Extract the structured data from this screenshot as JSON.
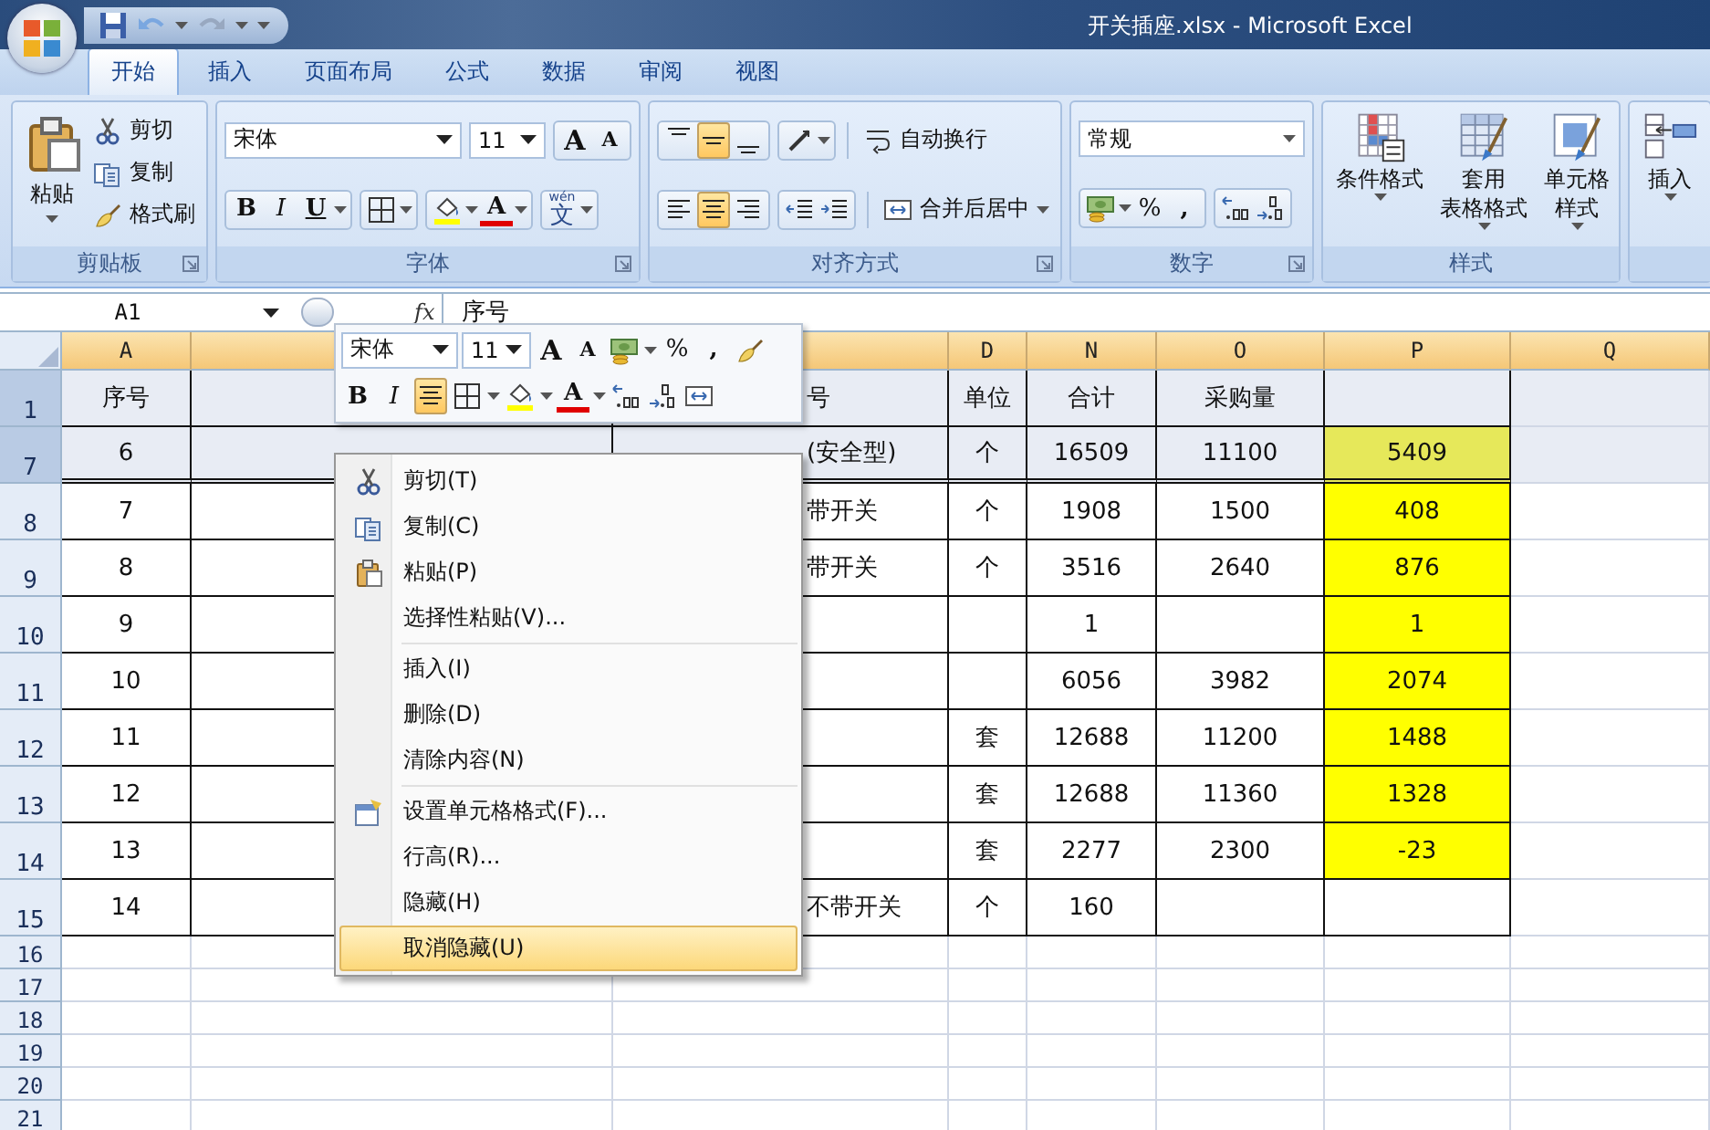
{
  "title_bar": {
    "title": "开关插座.xlsx - Microsoft Excel"
  },
  "tabs": [
    {
      "label": "开始",
      "selected": true
    },
    {
      "label": "插入",
      "selected": false
    },
    {
      "label": "页面布局",
      "selected": false
    },
    {
      "label": "公式",
      "selected": false
    },
    {
      "label": "数据",
      "selected": false
    },
    {
      "label": "审阅",
      "selected": false
    },
    {
      "label": "视图",
      "selected": false
    }
  ],
  "ribbon": {
    "clipboard": {
      "label": "剪贴板",
      "paste": "粘贴",
      "items": [
        {
          "label": "剪切"
        },
        {
          "label": "复制"
        },
        {
          "label": "格式刷"
        }
      ]
    },
    "font": {
      "label": "字体",
      "font_name": "宋体",
      "font_size": "11",
      "grow": "A",
      "shrink": "A",
      "bold": "B",
      "italic": "I",
      "underline": "U",
      "font_color": "A",
      "phonetic": {
        "ruby": "wén",
        "char": "文"
      }
    },
    "alignment": {
      "label": "对齐方式",
      "vertical": [
        {
          "kind": "top",
          "selected": false
        },
        {
          "kind": "middle",
          "selected": true
        },
        {
          "kind": "bottom",
          "selected": false
        }
      ],
      "horizontal": [
        {
          "kind": "left",
          "selected": false
        },
        {
          "kind": "center",
          "selected": true
        },
        {
          "kind": "right",
          "selected": false
        }
      ],
      "wrap": "自动换行",
      "merge": "合并后居中"
    },
    "number": {
      "label": "数字",
      "format": "常规",
      "percent": "%",
      "comma": ","
    },
    "styles": {
      "label": "样式",
      "buttons": [
        {
          "kind": "conditional",
          "lines": [
            "条件格式"
          ]
        },
        {
          "kind": "table",
          "lines": [
            "套用",
            "表格格式"
          ]
        },
        {
          "kind": "cell",
          "lines": [
            "单元格",
            "样式"
          ]
        }
      ]
    },
    "cells": {
      "buttons": [
        {
          "kind": "insert",
          "lines": [
            "插入"
          ]
        }
      ]
    }
  },
  "formula_bar": {
    "name_box": "A1",
    "fx": "fx",
    "formula": "序号"
  },
  "grid": {
    "columns": [
      {
        "label": "A"
      },
      {},
      {},
      {
        "label": "D"
      },
      {
        "label": "N"
      },
      {
        "label": "O"
      },
      {
        "label": "P"
      },
      {
        "label": "Q"
      }
    ],
    "rows": [
      {
        "header": "1",
        "selected": true,
        "highlighted": false,
        "rows_hidden_below": false,
        "cells": [
          "序号",
          null,
          "号",
          "单位",
          "合计",
          "采购量",
          null,
          null
        ]
      },
      {
        "header": "7",
        "selected": true,
        "highlighted": true,
        "rows_hidden_below": true,
        "cells": [
          "6",
          null,
          "(安全型)",
          "个",
          "16509",
          "11100",
          "5409",
          null
        ]
      },
      {
        "header": "8",
        "selected": false,
        "highlighted": true,
        "rows_hidden_below": false,
        "cells": [
          "7",
          null,
          "带开关",
          "个",
          "1908",
          "1500",
          "408",
          null
        ]
      },
      {
        "header": "9",
        "selected": false,
        "highlighted": true,
        "rows_hidden_below": false,
        "cells": [
          "8",
          null,
          "带开关",
          "个",
          "3516",
          "2640",
          "876",
          null
        ]
      },
      {
        "header": "10",
        "selected": false,
        "highlighted": true,
        "rows_hidden_below": false,
        "cells": [
          "9",
          null,
          null,
          null,
          "1",
          null,
          "1",
          null
        ]
      },
      {
        "header": "11",
        "selected": false,
        "highlighted": true,
        "rows_hidden_below": false,
        "cells": [
          "10",
          null,
          null,
          null,
          "6056",
          "3982",
          "2074",
          null
        ]
      },
      {
        "header": "12",
        "selected": false,
        "highlighted": true,
        "rows_hidden_below": false,
        "cells": [
          "11",
          null,
          null,
          "套",
          "12688",
          "11200",
          "1488",
          null
        ]
      },
      {
        "header": "13",
        "selected": false,
        "highlighted": true,
        "rows_hidden_below": false,
        "cells": [
          "12",
          null,
          null,
          "套",
          "12688",
          "11360",
          "1328",
          null
        ]
      },
      {
        "header": "14",
        "selected": false,
        "highlighted": true,
        "rows_hidden_below": false,
        "cells": [
          "13",
          null,
          null,
          "套",
          "2277",
          "2300",
          "-23",
          null
        ]
      },
      {
        "header": "15",
        "selected": false,
        "highlighted": false,
        "rows_hidden_below": false,
        "cells": [
          "14",
          null,
          "不带开关",
          "个",
          "160",
          null,
          null,
          null
        ]
      }
    ],
    "blank_rows": [
      "16",
      "17",
      "18",
      "19",
      "20",
      "21"
    ]
  },
  "mini_toolbar": {
    "font_name": "宋体",
    "font_size": "11",
    "grow": "A",
    "shrink": "A",
    "percent": "%",
    "comma": ",",
    "bold": "B",
    "italic": "I",
    "center_selected": true,
    "font_color": "A"
  },
  "context_menu": {
    "groups": [
      [
        {
          "label": "剪切(T)",
          "selected": false
        },
        {
          "label": "复制(C)",
          "selected": false
        },
        {
          "label": "粘贴(P)",
          "selected": false
        },
        {
          "label": "选择性粘贴(V)...",
          "selected": false
        }
      ],
      [
        {
          "label": "插入(I)",
          "selected": false
        },
        {
          "label": "删除(D)",
          "selected": false
        },
        {
          "label": "清除内容(N)",
          "selected": false
        }
      ],
      [
        {
          "label": "设置单元格格式(F)...",
          "selected": false
        },
        {
          "label": "行高(R)...",
          "selected": false
        },
        {
          "label": "隐藏(H)",
          "selected": false
        },
        {
          "label": "取消隐藏(U)",
          "selected": true
        }
      ]
    ]
  }
}
